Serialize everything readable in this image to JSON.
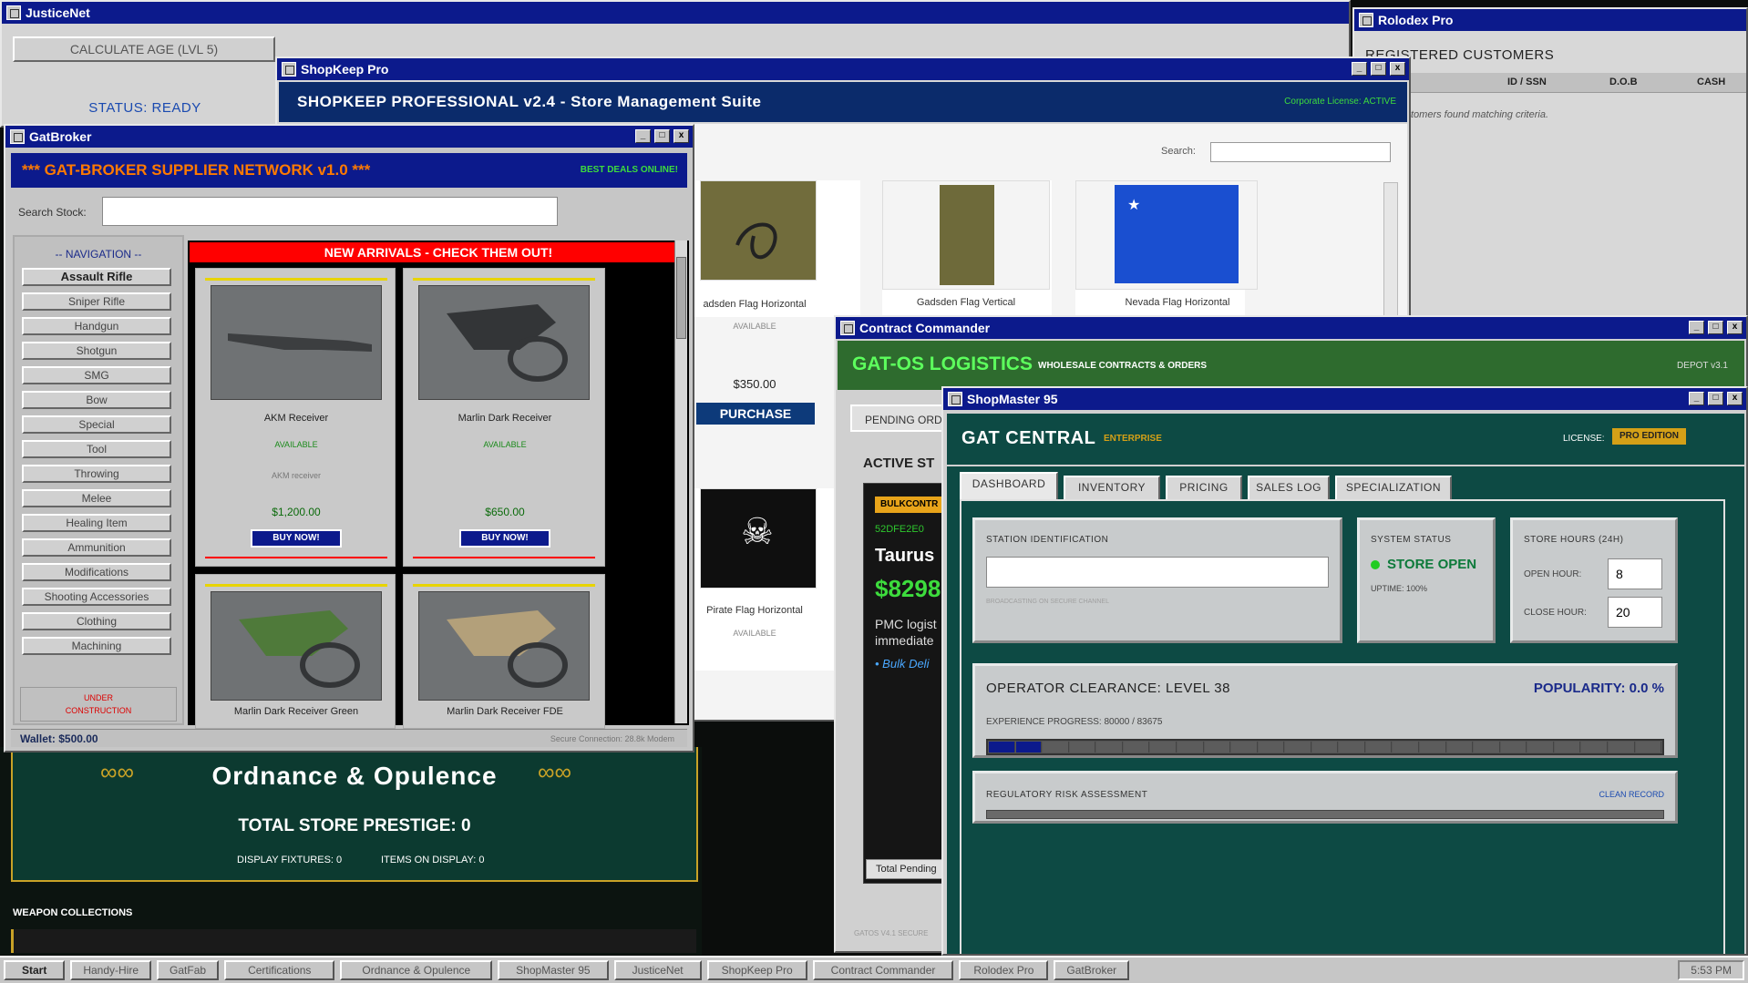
{
  "justicenet": {
    "title": "JusticeNet",
    "calc_button": "CALCULATE AGE (LVL 5)",
    "status": "STATUS: READY"
  },
  "rolodex": {
    "title": "Rolodex Pro",
    "heading": "REGISTERED CUSTOMERS",
    "columns": [
      "ID / SSN",
      "D.O.B",
      "CASH"
    ],
    "empty_text": "tomers found matching criteria."
  },
  "shopkeep": {
    "title": "ShopKeep Pro",
    "banner": "SHOPKEEP PROFESSIONAL v2.4 - Store Management Suite",
    "license": "Corporate License: ACTIVE",
    "search_label": "Search:",
    "search_value": "",
    "products": [
      {
        "name": "adsden Flag Horizontal",
        "status": "AVAILABLE",
        "price": "$350.00"
      },
      {
        "name": "Gadsden Flag Vertical"
      },
      {
        "name": "Nevada Flag Horizontal"
      },
      {
        "name": "Pirate Flag Horizontal",
        "status": "AVAILABLE"
      }
    ],
    "purchase_label": "PURCHASE",
    "colors": {
      "banner": "#0b2b6b",
      "button": "#0d3a7a"
    }
  },
  "gatbroker": {
    "title": "GatBroker",
    "banner": "*** GAT-BROKER SUPPLIER NETWORK v1.0 ***",
    "banner_right": "BEST DEALS ONLINE!",
    "search_label": "Search Stock:",
    "search_value": "",
    "nav_title": "-- NAVIGATION --",
    "nav_items": [
      "Assault Rifle",
      "Sniper Rifle",
      "Handgun",
      "Shotgun",
      "SMG",
      "Bow",
      "Special",
      "Tool",
      "Throwing",
      "Melee",
      "Healing Item",
      "Ammunition",
      "Modifications",
      "Shooting Accessories",
      "Clothing",
      "Machining"
    ],
    "under_construction": [
      "UNDER",
      "CONSTRUCTION"
    ],
    "arrivals_banner": "NEW ARRIVALS - CHECK THEM OUT!",
    "items": [
      {
        "name": "AKM Receiver",
        "status": "AVAILABLE",
        "desc": "AKM receiver",
        "price": "$1,200.00",
        "button": "BUY NOW!"
      },
      {
        "name": "Marlin Dark Receiver",
        "status": "AVAILABLE",
        "desc": "",
        "price": "$650.00",
        "button": "BUY NOW!"
      },
      {
        "name": "Marlin Dark Receiver Green"
      },
      {
        "name": "Marlin Dark Receiver FDE"
      }
    ],
    "wallet": "Wallet: $500.00",
    "connection": "Secure Connection: 28.8k Modem",
    "colors": {
      "banner_text": "#ff7a00",
      "arrivals": "#ff0000",
      "available": "#1a8a1a",
      "price": "#0a6a0a"
    }
  },
  "ordnance": {
    "title": "Ordnance & Opulence",
    "prestige": "TOTAL STORE PRESTIGE: 0",
    "fixtures": "DISPLAY FIXTURES: 0",
    "items_on_display": "ITEMS ON DISPLAY: 0",
    "collections": "WEAPON COLLECTIONS"
  },
  "contract": {
    "title": "Contract Commander",
    "brand": "GAT-OS LOGISTICS",
    "subtitle": "WHOLESALE CONTRACTS & ORDERS",
    "depot": "DEPOT v3.1",
    "tab_pending": "PENDING ORD",
    "active_label": "ACTIVE ST",
    "badge": "BULKCONTR",
    "contract_id": "52DFE2E0",
    "client": "Taurus",
    "amount": "$8298",
    "desc_line1": "PMC logist",
    "desc_line2": "immediate",
    "bullet": "• Bulk Deli",
    "total_pending": "Total Pending",
    "footer": "GATOS V4.1 SECURE"
  },
  "shopmaster": {
    "title": "ShopMaster 95",
    "store_name": "GAT CENTRAL",
    "tier": "ENTERPRISE",
    "license_label": "LICENSE:",
    "license_value": "PRO EDITION",
    "tabs": [
      "DASHBOARD",
      "INVENTORY",
      "PRICING",
      "SALES LOG",
      "SPECIALIZATION"
    ],
    "station_label": "STATION IDENTIFICATION",
    "station_value": "",
    "station_hint": "BROADCASTING ON SECURE CHANNEL",
    "system_status_label": "SYSTEM STATUS",
    "system_status_value": "STORE OPEN",
    "uptime": "UPTIME: 100%",
    "hours_label": "STORE HOURS (24H)",
    "open_label": "OPEN HOUR:",
    "open_value": "8",
    "close_label": "CLOSE HOUR:",
    "close_value": "20",
    "clearance": "OPERATOR CLEARANCE: LEVEL 38",
    "popularity": "POPULARITY: 0.0 %",
    "xp_label": "EXPERIENCE PROGRESS: 80000 / 83675",
    "xp_progress_segments": 2,
    "xp_total_segments": 25,
    "risk_label": "REGULATORY RISK ASSESSMENT",
    "risk_status": "CLEAN RECORD",
    "colors": {
      "header": "#0d4a44",
      "accent": "#d4a017",
      "open": "#22cc22"
    }
  },
  "taskbar": {
    "start": "Start",
    "items": [
      "Handy-Hire",
      "GatFab",
      "Certifications",
      "Ordnance & Opulence",
      "ShopMaster 95",
      "JusticeNet",
      "ShopKeep Pro",
      "Contract Commander",
      "Rolodex Pro",
      "GatBroker"
    ],
    "clock": "5:53 PM"
  }
}
